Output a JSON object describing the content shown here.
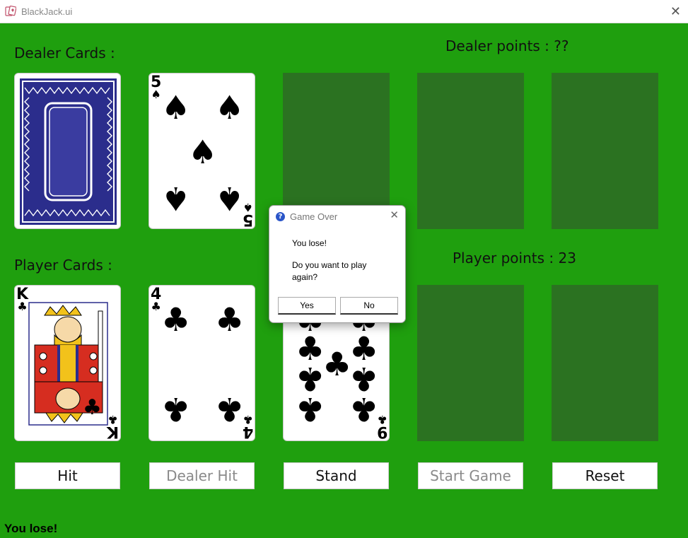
{
  "window": {
    "title": "BlackJack.ui",
    "close_glyph": "✕",
    "icon": "cards-app-icon"
  },
  "dealer": {
    "cards_label": "Dealer Cards :",
    "points_label": "Dealer points : ??",
    "cards": [
      {
        "face": "back"
      },
      {
        "rank": "5",
        "suit": "♠"
      }
    ]
  },
  "player": {
    "cards_label": "Player Cards :",
    "points_label": "Player points : 23",
    "cards": [
      {
        "rank": "K",
        "suit": "♣"
      },
      {
        "rank": "4",
        "suit": "♣"
      },
      {
        "rank": "9",
        "suit": "♣"
      }
    ]
  },
  "buttons": {
    "hit": "Hit",
    "dealer_hit": "Dealer Hit",
    "stand": "Stand",
    "start_game": "Start Game",
    "reset": "Reset"
  },
  "status": "You lose!",
  "dialog": {
    "title": "Game Over",
    "icon_glyph": "?",
    "close_glyph": "✕",
    "message": "You lose!",
    "question": "Do you want to play again?",
    "yes": "Yes",
    "no": "No"
  },
  "colors": {
    "felt": "#1f9f0e",
    "empty_slot": "#2b7221",
    "card_back": "#2b2d8c"
  }
}
